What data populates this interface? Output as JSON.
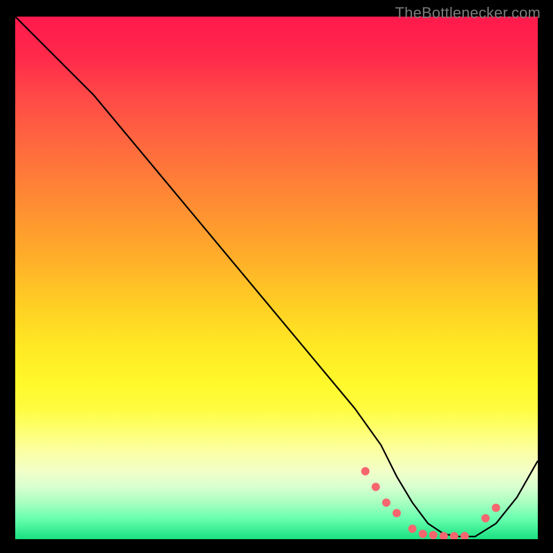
{
  "watermark": "TheBottlenecker.com",
  "chart_data": {
    "type": "line",
    "title": "",
    "xlabel": "",
    "ylabel": "",
    "xlim": [
      0,
      100
    ],
    "ylim": [
      0,
      100
    ],
    "series": [
      {
        "name": "curve",
        "x": [
          0,
          4,
          8,
          15,
          25,
          35,
          45,
          55,
          65,
          70,
          73,
          76,
          79,
          82,
          85,
          88,
          92,
          96,
          100
        ],
        "y": [
          100,
          96,
          92,
          85,
          73,
          61,
          49,
          37,
          25,
          18,
          12,
          7,
          3,
          1,
          0.5,
          0.5,
          3,
          8,
          15
        ]
      }
    ],
    "markers": {
      "name": "highlight-dots",
      "color": "#f5666e",
      "x": [
        67,
        69,
        71,
        73,
        76,
        78,
        80,
        82,
        84,
        86,
        90,
        92
      ],
      "y": [
        13,
        10,
        7,
        5,
        2,
        1,
        0.8,
        0.6,
        0.6,
        0.6,
        4,
        6
      ]
    }
  }
}
